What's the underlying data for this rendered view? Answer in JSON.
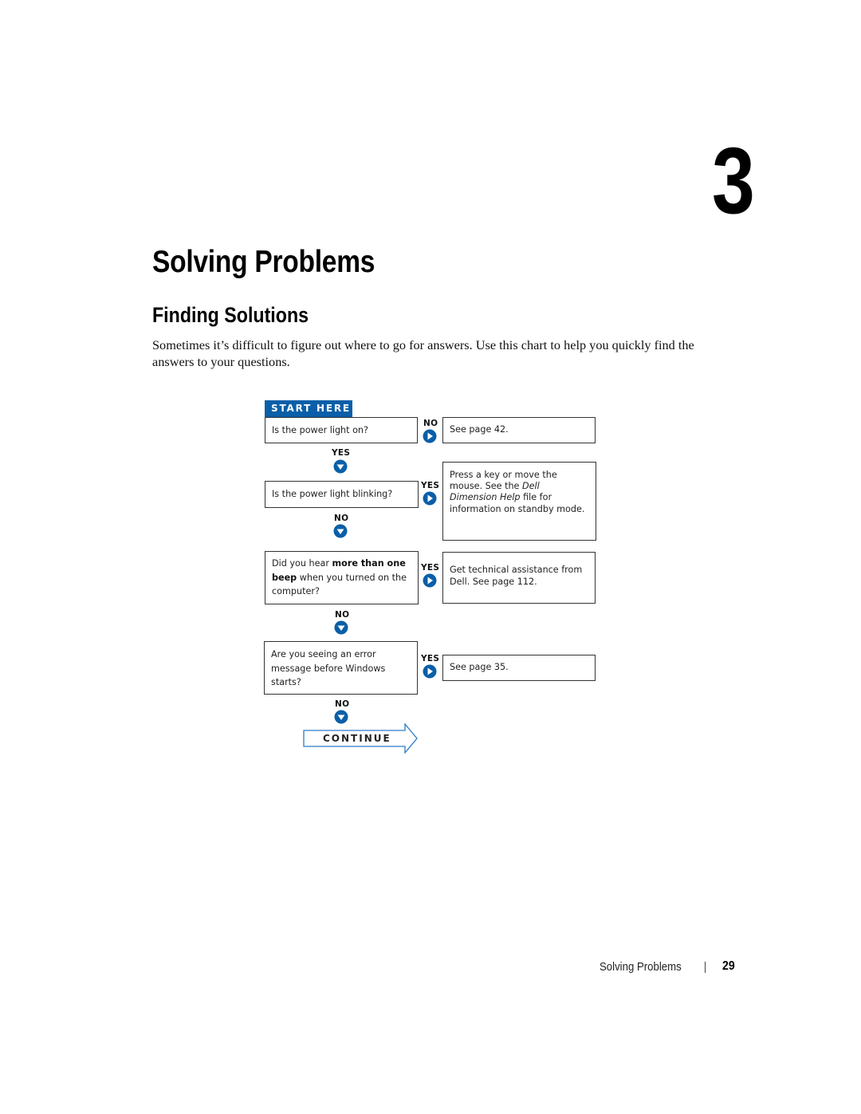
{
  "chapter": {
    "number": "3"
  },
  "page_title": "Solving Problems",
  "section_title": "Finding Solutions",
  "intro": "Sometimes it’s difficult to figure out where to go for answers. Use this chart to help you quickly find the answers to your questions.",
  "flowchart": {
    "start_label": "START HERE",
    "questions": [
      {
        "text": "Is the power light on?"
      },
      {
        "text": "Is the power light blinking?"
      },
      {
        "pre": "Did you hear ",
        "bold": "more than one beep",
        "post": " when you turned on the computer?"
      },
      {
        "text": "Are you seeing an error message before Windows starts?"
      }
    ],
    "answers": [
      {
        "text": "See page 42."
      },
      {
        "pre": "Press a key or move the mouse. See the ",
        "italic": "Dell Dimension Help",
        "post": " file for information on standby mode."
      },
      {
        "text": "Get technical assistance from Dell. See page 112."
      },
      {
        "text": "See page 35."
      }
    ],
    "side_labels": [
      "NO",
      "YES",
      "YES",
      "YES"
    ],
    "down_labels": [
      "YES",
      "NO",
      "NO",
      "NO"
    ],
    "continue_label": "CONTINUE",
    "accent_color": "#0a5fa8"
  },
  "footer": {
    "section": "Solving Problems",
    "page": "29"
  }
}
